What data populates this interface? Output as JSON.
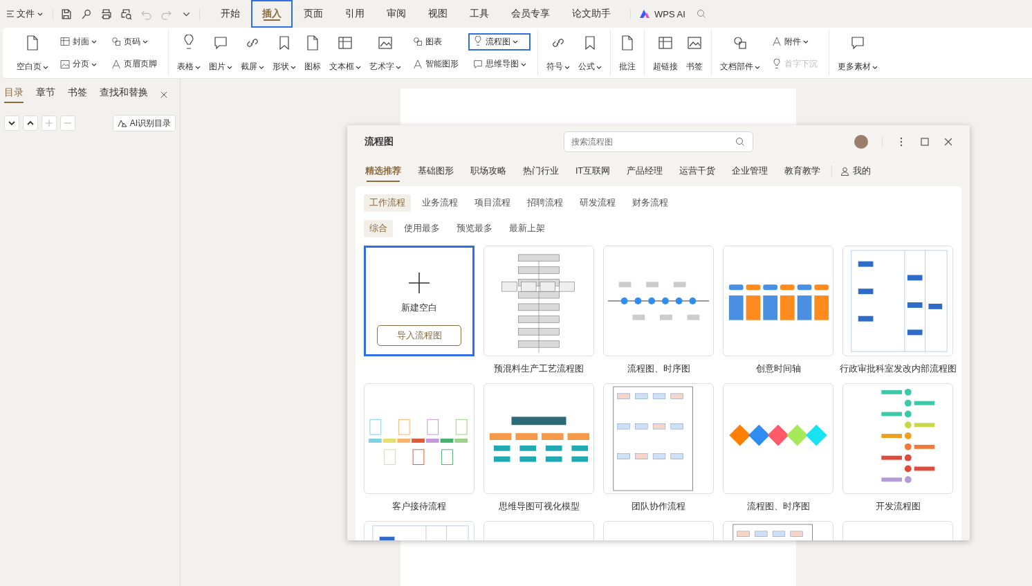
{
  "menu_bar": {
    "file_menu": "文件",
    "quick_access": [
      {
        "disabled": false
      },
      {
        "disabled": false
      },
      {
        "disabled": false
      },
      {
        "disabled": false
      },
      {
        "disabled": true
      },
      {
        "disabled": true
      },
      {
        "disabled": false
      }
    ],
    "tabs": [
      {
        "label": "开始",
        "selected": false,
        "highlighted": false
      },
      {
        "label": "插入",
        "selected": true,
        "highlighted": true
      },
      {
        "label": "页面",
        "selected": false,
        "highlighted": false
      },
      {
        "label": "引用",
        "selected": false,
        "highlighted": false
      },
      {
        "label": "审阅",
        "selected": false,
        "highlighted": false
      },
      {
        "label": "视图",
        "selected": false,
        "highlighted": false
      },
      {
        "label": "工具",
        "selected": false,
        "highlighted": false
      },
      {
        "label": "会员专享",
        "selected": false,
        "highlighted": false
      },
      {
        "label": "论文助手",
        "selected": false,
        "highlighted": false
      }
    ],
    "ai_label": "WPS AI"
  },
  "ribbon": {
    "groups": [
      [
        {
          "kind": "big",
          "label": "空白页",
          "dropdown": true
        },
        {
          "kind": "pair",
          "items": [
            {
              "label": "封面",
              "dropdown": true,
              "disabled": false,
              "highlighted": false
            },
            {
              "label": "分页",
              "dropdown": true,
              "disabled": false,
              "highlighted": false
            }
          ]
        },
        {
          "kind": "pair",
          "items": [
            {
              "label": "页码",
              "dropdown": true,
              "disabled": false,
              "highlighted": false
            },
            {
              "label": "页眉页脚",
              "dropdown": false,
              "disabled": false,
              "highlighted": false
            }
          ]
        }
      ],
      [
        {
          "kind": "big",
          "label": "表格",
          "dropdown": true
        },
        {
          "kind": "big",
          "label": "图片",
          "dropdown": true
        },
        {
          "kind": "big",
          "label": "截屏",
          "dropdown": true
        },
        {
          "kind": "big",
          "label": "形状",
          "dropdown": true
        },
        {
          "kind": "big",
          "label": "图标",
          "dropdown": false
        },
        {
          "kind": "big",
          "label": "文本框",
          "dropdown": true
        },
        {
          "kind": "big",
          "label": "艺术字",
          "dropdown": true
        },
        {
          "kind": "pair",
          "items": [
            {
              "label": "图表",
              "dropdown": false,
              "disabled": false,
              "highlighted": false
            },
            {
              "label": "智能图形",
              "dropdown": false,
              "disabled": false,
              "highlighted": false
            }
          ]
        },
        {
          "kind": "pair",
          "items": [
            {
              "label": "流程图",
              "dropdown": true,
              "disabled": false,
              "highlighted": true
            },
            {
              "label": "思维导图",
              "dropdown": true,
              "disabled": false,
              "highlighted": false
            }
          ]
        }
      ],
      [
        {
          "kind": "big",
          "label": "符号",
          "dropdown": true
        },
        {
          "kind": "big",
          "label": "公式",
          "dropdown": true
        }
      ],
      [
        {
          "kind": "big",
          "label": "批注",
          "dropdown": false
        }
      ],
      [
        {
          "kind": "big",
          "label": "超链接",
          "dropdown": false
        },
        {
          "kind": "big",
          "label": "书签",
          "dropdown": false
        }
      ],
      [
        {
          "kind": "big",
          "label": "文档部件",
          "dropdown": true
        },
        {
          "kind": "pair",
          "items": [
            {
              "label": "附件",
              "dropdown": true,
              "disabled": false,
              "highlighted": false
            },
            {
              "label": "首字下沉",
              "dropdown": false,
              "disabled": true,
              "highlighted": false
            }
          ]
        }
      ],
      [
        {
          "kind": "big",
          "label": "更多素材",
          "dropdown": true
        }
      ]
    ]
  },
  "nav_pane": {
    "tabs": [
      {
        "label": "目录",
        "selected": true
      },
      {
        "label": "章节",
        "selected": false
      },
      {
        "label": "书签",
        "selected": false
      },
      {
        "label": "查找和替换",
        "selected": false
      }
    ],
    "tools": [
      {
        "disabled": false
      },
      {
        "disabled": false
      },
      {
        "disabled": true
      },
      {
        "disabled": true
      }
    ],
    "ai_button": "AI识别目录"
  },
  "dialog": {
    "title": "流程图",
    "search": {
      "placeholder": "搜索流程图"
    },
    "categories": [
      {
        "label": "精选推荐",
        "selected": true
      },
      {
        "label": "基础图形",
        "selected": false
      },
      {
        "label": "职场攻略",
        "selected": false
      },
      {
        "label": "热门行业",
        "selected": false
      },
      {
        "label": "IT互联网",
        "selected": false
      },
      {
        "label": "产品经理",
        "selected": false
      },
      {
        "label": "运营干货",
        "selected": false
      },
      {
        "label": "企业管理",
        "selected": false
      },
      {
        "label": "教育教学",
        "selected": false
      }
    ],
    "mine": "我的",
    "subcategories": [
      {
        "label": "工作流程",
        "selected": true
      },
      {
        "label": "业务流程",
        "selected": false
      },
      {
        "label": "项目流程",
        "selected": false
      },
      {
        "label": "招聘流程",
        "selected": false
      },
      {
        "label": "研发流程",
        "selected": false
      },
      {
        "label": "财务流程",
        "selected": false
      }
    ],
    "sort": [
      {
        "label": "综合",
        "selected": true
      },
      {
        "label": "使用最多",
        "selected": false
      },
      {
        "label": "预览最多",
        "selected": false
      },
      {
        "label": "最新上架",
        "selected": false
      }
    ],
    "cards": [
      {
        "kind": "new",
        "label": "新建空白",
        "button": "导入流程图",
        "highlighted": true
      },
      {
        "kind": "template",
        "title": "预混料生产工艺流程图"
      },
      {
        "kind": "template",
        "title": "流程图、时序图"
      },
      {
        "kind": "template",
        "title": "创意时间轴"
      },
      {
        "kind": "template",
        "title": "行政审批科室发改内部流程图"
      },
      {
        "kind": "template",
        "title": "客户接待流程"
      },
      {
        "kind": "template",
        "title": "思维导图可视化模型"
      },
      {
        "kind": "template",
        "title": "团队协作流程"
      },
      {
        "kind": "template",
        "title": "流程图、时序图"
      },
      {
        "kind": "template",
        "title": "开发流程图"
      },
      {
        "kind": "partial"
      },
      {
        "kind": "partial"
      },
      {
        "kind": "partial"
      },
      {
        "kind": "partial"
      },
      {
        "kind": "partial"
      }
    ]
  }
}
